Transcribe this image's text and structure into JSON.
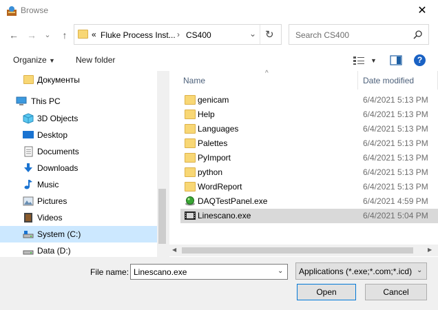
{
  "window": {
    "title": "Browse",
    "close_glyph": "✕"
  },
  "nav": {
    "back": "←",
    "forward": "→",
    "recent": "⌄",
    "up": "↑"
  },
  "address": {
    "overflow": "«",
    "path": [
      "Fluke Process Inst...",
      "CS400"
    ],
    "sep": "›",
    "dropdown": "⌄",
    "refresh": "↻"
  },
  "search": {
    "placeholder": "Search CS400",
    "icon": "⚲"
  },
  "toolbar": {
    "organize_label": "Organize",
    "organize_arrow": "▼",
    "new_folder_label": "New folder",
    "view_arrow": "▼",
    "help": "?"
  },
  "sidebar": {
    "items": [
      {
        "label": "Документы",
        "icon": "folder-icon"
      },
      {
        "label": "This PC",
        "icon": "computer-icon"
      },
      {
        "label": "3D Objects",
        "icon": "cube-icon"
      },
      {
        "label": "Desktop",
        "icon": "desktop-icon"
      },
      {
        "label": "Documents",
        "icon": "document-icon"
      },
      {
        "label": "Downloads",
        "icon": "download-icon"
      },
      {
        "label": "Music",
        "icon": "music-icon"
      },
      {
        "label": "Pictures",
        "icon": "picture-icon"
      },
      {
        "label": "Videos",
        "icon": "video-icon"
      },
      {
        "label": "System (C:)",
        "icon": "drive-icon"
      },
      {
        "label": "Data (D:)",
        "icon": "drive-icon"
      }
    ]
  },
  "files": {
    "columns": {
      "name": "Name",
      "date": "Date modified",
      "sort": "^"
    },
    "rows": [
      {
        "name": "genicam",
        "date": "6/4/2021 5:13 PM",
        "icon": "folder-icon"
      },
      {
        "name": "Help",
        "date": "6/4/2021 5:13 PM",
        "icon": "folder-icon"
      },
      {
        "name": "Languages",
        "date": "6/4/2021 5:13 PM",
        "icon": "folder-icon"
      },
      {
        "name": "Palettes",
        "date": "6/4/2021 5:13 PM",
        "icon": "folder-icon"
      },
      {
        "name": "PyImport",
        "date": "6/4/2021 5:13 PM",
        "icon": "folder-icon"
      },
      {
        "name": "python",
        "date": "6/4/2021 5:13 PM",
        "icon": "folder-icon"
      },
      {
        "name": "WordReport",
        "date": "6/4/2021 5:13 PM",
        "icon": "folder-icon"
      },
      {
        "name": "DAQTestPanel.exe",
        "date": "6/4/2021 4:59 PM",
        "icon": "green-orb-icon"
      },
      {
        "name": "Linescano.exe",
        "date": "6/4/2021 5:04 PM",
        "icon": "film-icon"
      }
    ]
  },
  "footer": {
    "file_name_label": "File name:",
    "file_name_value": "Linescano.exe",
    "file_type": "Applications (*.exe;*.com;*.icd)",
    "open_label": "Open",
    "cancel_label": "Cancel"
  }
}
